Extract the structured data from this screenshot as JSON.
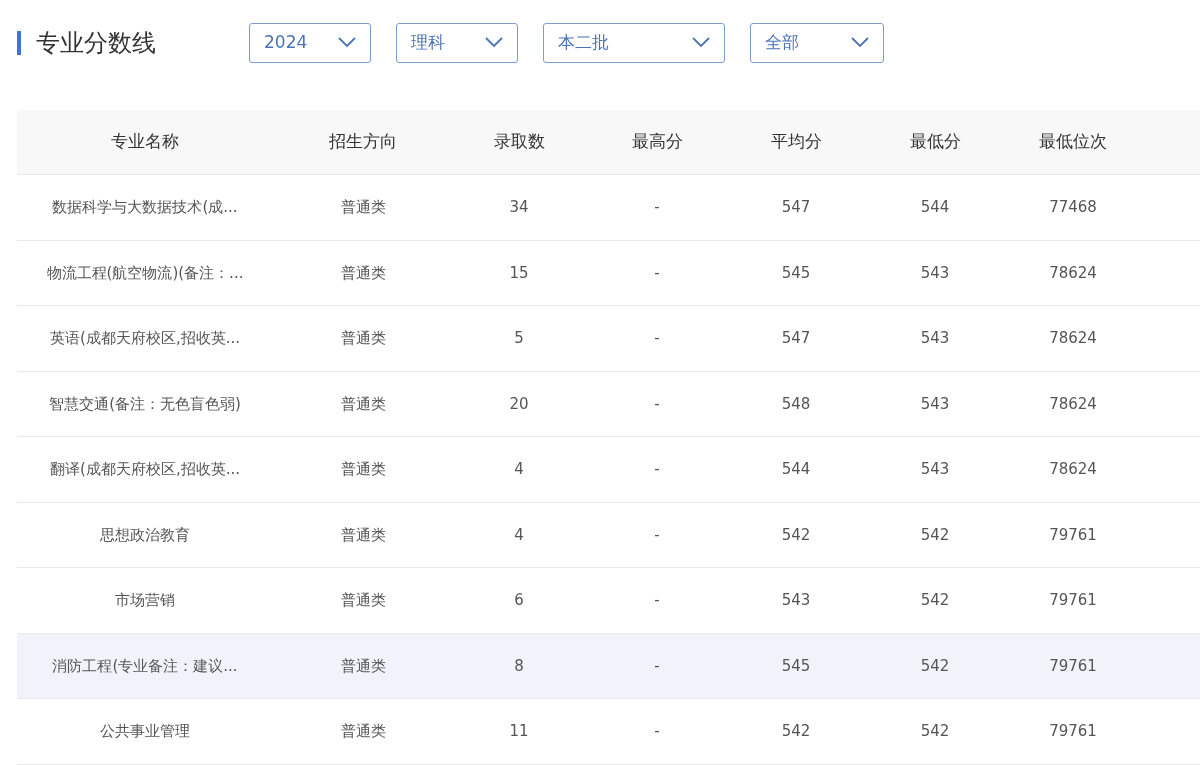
{
  "title": "专业分数线",
  "filters": [
    {
      "value": "2024"
    },
    {
      "value": "理科"
    },
    {
      "value": "本二批"
    },
    {
      "value": "全部"
    }
  ],
  "table": {
    "columns": [
      "专业名称",
      "招生方向",
      "录取数",
      "最高分",
      "平均分",
      "最低分",
      "最低位次"
    ],
    "rows": [
      {
        "hovered": false,
        "cells": [
          "数据科学与大数据技术(成...",
          "普通类",
          "34",
          "-",
          "547",
          "544",
          "77468"
        ]
      },
      {
        "hovered": false,
        "cells": [
          "物流工程(航空物流)(备注：...",
          "普通类",
          "15",
          "-",
          "545",
          "543",
          "78624"
        ]
      },
      {
        "hovered": false,
        "cells": [
          "英语(成都天府校区,招收英...",
          "普通类",
          "5",
          "-",
          "547",
          "543",
          "78624"
        ]
      },
      {
        "hovered": false,
        "cells": [
          "智慧交通(备注：无色盲色弱)",
          "普通类",
          "20",
          "-",
          "548",
          "543",
          "78624"
        ]
      },
      {
        "hovered": false,
        "cells": [
          "翻译(成都天府校区,招收英...",
          "普通类",
          "4",
          "-",
          "544",
          "543",
          "78624"
        ]
      },
      {
        "hovered": false,
        "cells": [
          "思想政治教育",
          "普通类",
          "4",
          "-",
          "542",
          "542",
          "79761"
        ]
      },
      {
        "hovered": false,
        "cells": [
          "市场营销",
          "普通类",
          "6",
          "-",
          "543",
          "542",
          "79761"
        ]
      },
      {
        "hovered": true,
        "cells": [
          "消防工程(专业备注：建议...",
          "普通类",
          "8",
          "-",
          "545",
          "542",
          "79761"
        ]
      },
      {
        "hovered": false,
        "cells": [
          "公共事业管理",
          "普通类",
          "11",
          "-",
          "542",
          "542",
          "79761"
        ]
      }
    ]
  }
}
